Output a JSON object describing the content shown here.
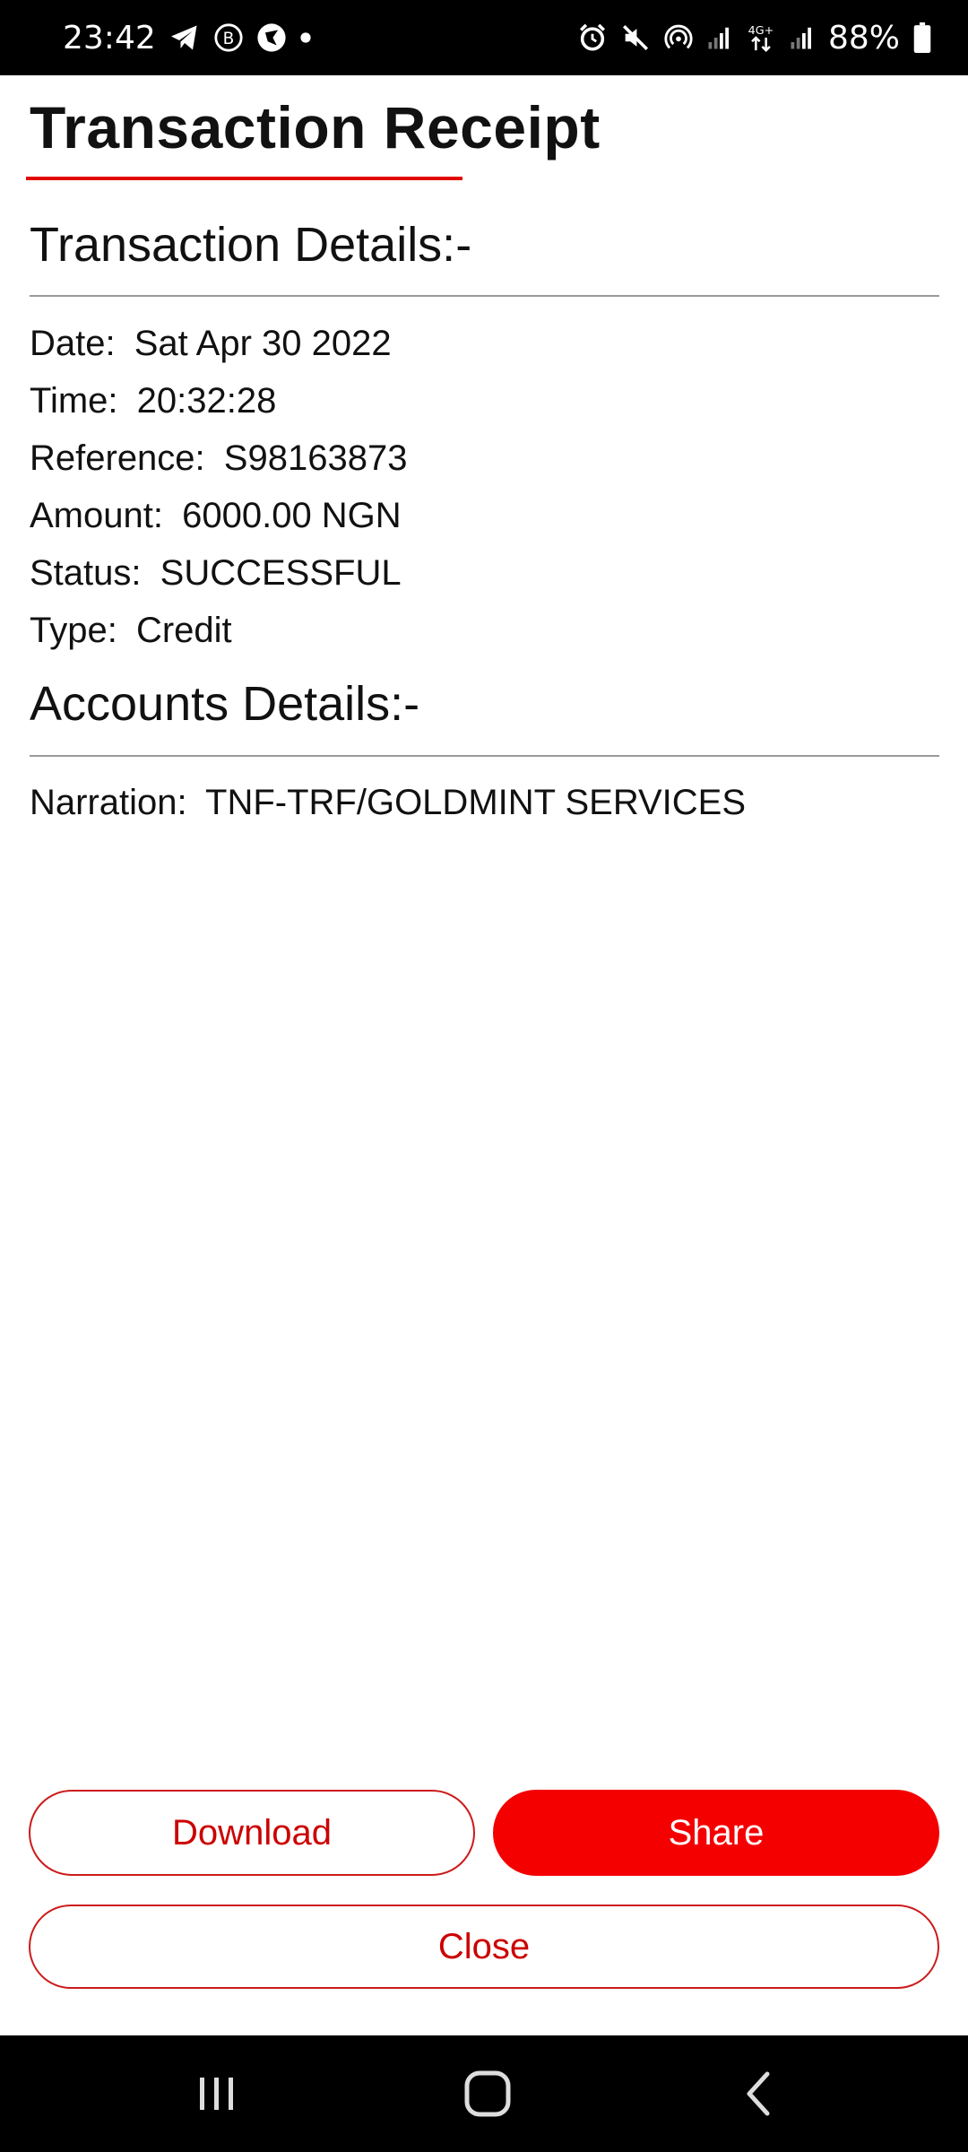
{
  "status_bar": {
    "time": "23:42",
    "battery": "88%",
    "left_icons": [
      "telegram-icon",
      "b-circle-icon",
      "browser-icon",
      "dot-icon"
    ],
    "right_icons": [
      "alarm-icon",
      "mute-icon",
      "hotspot-icon",
      "signal-icon",
      "4g-plus-icon",
      "signal-icon",
      "battery-icon"
    ],
    "network_label": "4G+"
  },
  "page": {
    "title": "Transaction Receipt",
    "accent_color": "#e10600"
  },
  "transaction_section": {
    "heading": "Transaction Details:-",
    "rows": [
      {
        "label": "Date:",
        "value": "Sat Apr 30 2022"
      },
      {
        "label": "Time:",
        "value": "20:32:28"
      },
      {
        "label": "Reference:",
        "value": "S98163873"
      },
      {
        "label": "Amount:",
        "value": "6000.00 NGN"
      },
      {
        "label": "Status:",
        "value": "SUCCESSFUL"
      },
      {
        "label": "Type:",
        "value": "Credit"
      }
    ]
  },
  "accounts_section": {
    "heading": "Accounts Details:-",
    "rows": [
      {
        "label": "Narration:",
        "value": "TNF-TRF/GOLDMINT SERVICES"
      }
    ]
  },
  "actions": {
    "download_label": "Download",
    "share_label": "Share",
    "close_label": "Close"
  },
  "nav_bar": {
    "icons": [
      "recent-apps-icon",
      "home-icon",
      "back-icon"
    ]
  }
}
